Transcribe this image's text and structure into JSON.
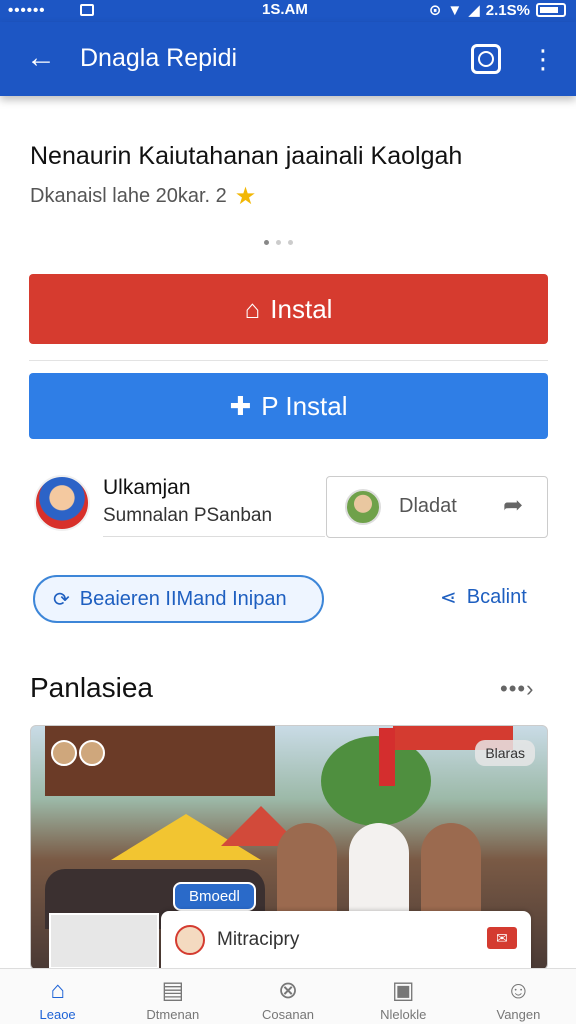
{
  "status_bar": {
    "signal": "••••••",
    "time": "1S.AM",
    "battery": "2.1S%"
  },
  "app_bar": {
    "title": "Dnagla Repidi"
  },
  "app": {
    "headline": "Nenaurin Kaiutahanan jaainali Kaolgah",
    "subtitle": "Dkanaisl lahe 20kar. 2",
    "rating_icon": "star-icon"
  },
  "buttons": {
    "install_primary": "Instal",
    "install_secondary": "P Instal"
  },
  "author": {
    "name": "Ulkamjan",
    "subtitle": "Sumnalan PSanban"
  },
  "download_box": {
    "label": "Dladat"
  },
  "chip": {
    "label": "Beaieren IIMand Inipan"
  },
  "share": {
    "label": "Bcalint"
  },
  "section": {
    "title": "Panlasiea",
    "more": "•••›"
  },
  "photo": {
    "tag_top": "Blaras",
    "tag_mid": "Bmoedl",
    "chat_text": "Mitracipry"
  },
  "nav": [
    {
      "label": "Leaoe",
      "icon": "home-icon"
    },
    {
      "label": "Dtmenan",
      "icon": "book-icon"
    },
    {
      "label": "Cosanan",
      "icon": "compass-icon"
    },
    {
      "label": "Nlelokle",
      "icon": "document-icon"
    },
    {
      "label": "Vangen",
      "icon": "person-icon"
    }
  ],
  "colors": {
    "app_bar": "#1d56c4",
    "install_red": "#d63b2f",
    "install_blue": "#2f7ee6",
    "accent": "#1e5fc0"
  }
}
